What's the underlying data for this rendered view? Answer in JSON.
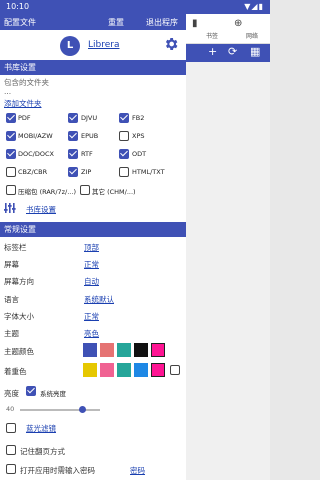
{
  "status": {
    "time": "10:10",
    "icons": "▼◢▮"
  },
  "background_app": {
    "tab1": "书签",
    "tab2": "网络"
  },
  "header": {
    "config_file": "配置文件",
    "reset": "重置",
    "exit": "退出程序"
  },
  "profile": {
    "avatar_letter": "L",
    "name": "Librera"
  },
  "library": {
    "title": "书库设置",
    "include_folder_label": "包含的文件夹",
    "folder_value": "...",
    "add_folder": "添加文件夹",
    "formats": [
      {
        "label": "PDF",
        "checked": true
      },
      {
        "label": "DJVU",
        "checked": true
      },
      {
        "label": "FB2",
        "checked": true
      },
      {
        "label": "MOBI/AZW",
        "checked": true
      },
      {
        "label": "EPUB",
        "checked": true
      },
      {
        "label": "XPS",
        "checked": false
      },
      {
        "label": "DOC/DOCX",
        "checked": true
      },
      {
        "label": "RTF",
        "checked": true
      },
      {
        "label": "ODT",
        "checked": true
      },
      {
        "label": "CBZ/CBR",
        "checked": false
      },
      {
        "label": "ZIP",
        "checked": true
      },
      {
        "label": "HTML/TXT",
        "checked": false
      },
      {
        "label": "压缩包 (RAR/7z/...)",
        "checked": false
      },
      {
        "label": "其它 (CHM/...)",
        "checked": false
      }
    ],
    "settings_link": "书库设置"
  },
  "general": {
    "title": "常规设置",
    "rows": [
      {
        "label": "标签栏",
        "value": "顶部"
      },
      {
        "label": "屏幕",
        "value": "正常"
      },
      {
        "label": "屏幕方向",
        "value": "自动"
      },
      {
        "label": "语言",
        "value": "系统默认"
      },
      {
        "label": "字体大小",
        "value": "正常"
      },
      {
        "label": "主题",
        "value": "亮色"
      }
    ],
    "theme_color_label": "主题颜色",
    "theme_colors": [
      "#3f51b5",
      "#e57373",
      "#26a69a",
      "#111111",
      "#ff1493"
    ],
    "accent_label": "着重色",
    "accent_colors": [
      "#e6c800",
      "#f06292",
      "#26a69a",
      "#1e88e5",
      "#ff1493"
    ],
    "brightness_label": "亮度",
    "system_brightness": "系统亮度",
    "brightness_value": "40",
    "brightness_level": 0.78,
    "blue_filter": "蓝光滤镜",
    "remember_page": "记住翻页方式",
    "require_password": "打开应用时需输入密码",
    "password_link": "密码"
  }
}
